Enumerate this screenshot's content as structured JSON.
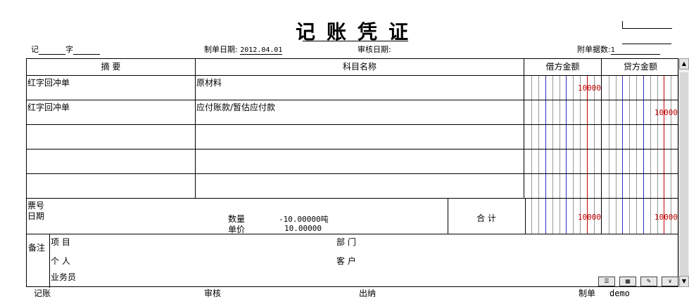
{
  "title_chars": [
    "记",
    "账",
    "凭",
    "证"
  ],
  "header": {
    "type_label": "记",
    "word_label": "字",
    "date_label": "制单日期:",
    "date_value": "2012.04.01",
    "audit_label": "审核日期:",
    "attach_label": "附单据数:",
    "attach_value": "1"
  },
  "columns": {
    "summary": "摘 要",
    "account": "科目名称",
    "debit": "借方金额",
    "credit": "贷方金额"
  },
  "rows": [
    {
      "summary": "红字回冲单",
      "account": "原材料",
      "debit": "10000",
      "credit": ""
    },
    {
      "summary": "红字回冲单",
      "account": "应付账款/暂估应付款",
      "debit": "",
      "credit": "10000"
    },
    {
      "summary": "",
      "account": "",
      "debit": "",
      "credit": ""
    },
    {
      "summary": "",
      "account": "",
      "debit": "",
      "credit": ""
    },
    {
      "summary": "",
      "account": "",
      "debit": "",
      "credit": ""
    }
  ],
  "info": {
    "ticket_label": "票号",
    "date_label": "日期",
    "qty_label": "数量",
    "qty_value": "-10.00000吨",
    "price_label": "单价",
    "price_value": "10.00000",
    "total_label": "合 计",
    "total_debit": "10000",
    "total_credit": "10000"
  },
  "remarks": {
    "label": "备注",
    "project": "项 目",
    "dept": "部 门",
    "person": "个 人",
    "customer": "客 户",
    "salesman": "业务员"
  },
  "footer": {
    "bookkeeper": "记账",
    "auditor": "审核",
    "cashier": "出纳",
    "maker_label": "制单",
    "maker_value": "demo"
  },
  "colors": {
    "ledger_red": "#c00000",
    "ledger_blue": "#3030c0"
  }
}
